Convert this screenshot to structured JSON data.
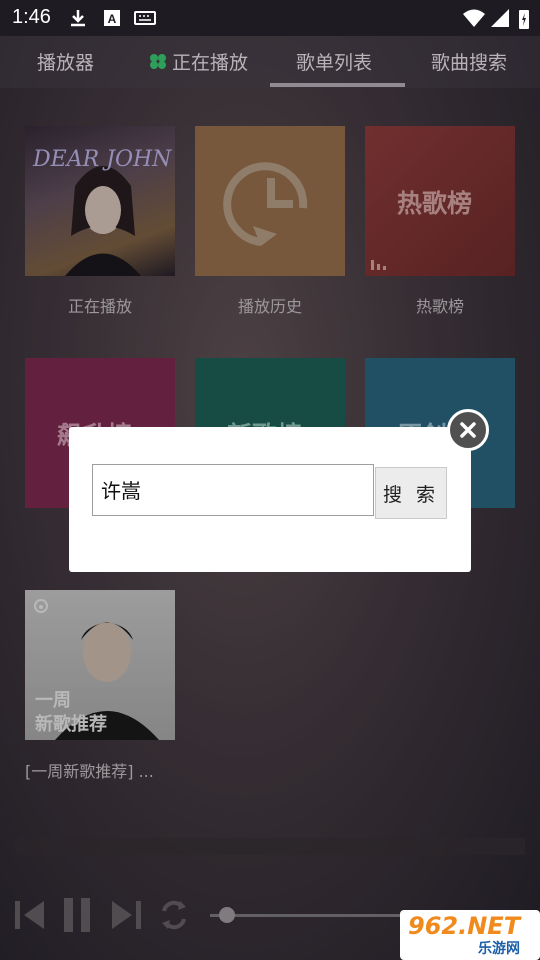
{
  "status_bar": {
    "time": "1:46"
  },
  "tabs": [
    {
      "label": "播放器"
    },
    {
      "label": "正在播放"
    },
    {
      "label": "歌单列表"
    },
    {
      "label": "歌曲搜索"
    }
  ],
  "tiles": [
    {
      "label": "正在播放",
      "cover_text": "DEAR JOHN"
    },
    {
      "label": "播放历史"
    },
    {
      "label": "热歌榜",
      "cover_text": "热歌榜"
    },
    {
      "cover_text": "飙升榜"
    },
    {
      "cover_text": "新歌榜"
    },
    {
      "cover_text": "原创"
    },
    {
      "label": "[一周新歌推荐] ...",
      "cover_text_1": "一周",
      "cover_text_2": "新歌推荐"
    }
  ],
  "dialog": {
    "search_value": "许嵩",
    "search_button": "搜 索"
  },
  "watermark": {
    "brand": "962.NET",
    "sub": "乐游网"
  },
  "colors": {
    "history_tile": "#a77a55",
    "hot_tile": "#8c3a3a",
    "rise_tile": "#8a2f58",
    "new_tile": "#1f6a5e",
    "orig_tile": "#2f6e8a"
  }
}
